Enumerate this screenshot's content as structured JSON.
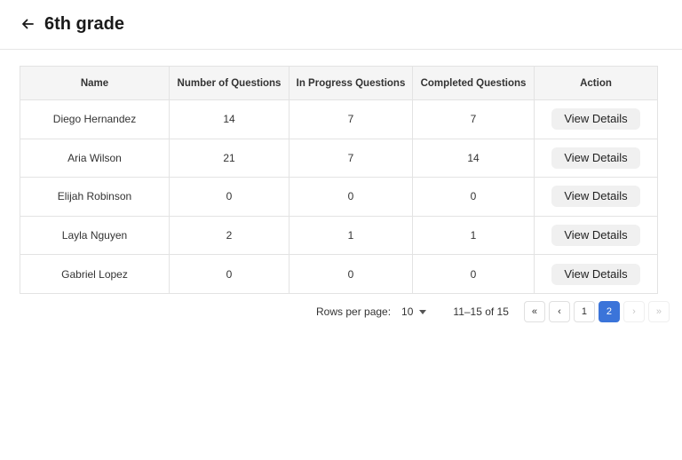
{
  "header": {
    "title": "6th grade"
  },
  "table": {
    "columns": [
      "Name",
      "Number of Questions",
      "In Progress Questions",
      "Completed Questions",
      "Action"
    ],
    "rows": [
      {
        "name": "Diego Hernandez",
        "total": "14",
        "in_progress": "7",
        "completed": "7",
        "action": "View Details"
      },
      {
        "name": "Aria Wilson",
        "total": "21",
        "in_progress": "7",
        "completed": "14",
        "action": "View Details"
      },
      {
        "name": "Elijah Robinson",
        "total": "0",
        "in_progress": "0",
        "completed": "0",
        "action": "View Details"
      },
      {
        "name": "Layla Nguyen",
        "total": "2",
        "in_progress": "1",
        "completed": "1",
        "action": "View Details"
      },
      {
        "name": "Gabriel Lopez",
        "total": "0",
        "in_progress": "0",
        "completed": "0",
        "action": "View Details"
      }
    ]
  },
  "pagination": {
    "rows_per_page_label": "Rows per page:",
    "rows_per_page_value": "10",
    "range": "11–15 of 15",
    "first": "«",
    "prev": "‹",
    "pages": [
      "1",
      "2"
    ],
    "next": "›",
    "last": "»"
  }
}
